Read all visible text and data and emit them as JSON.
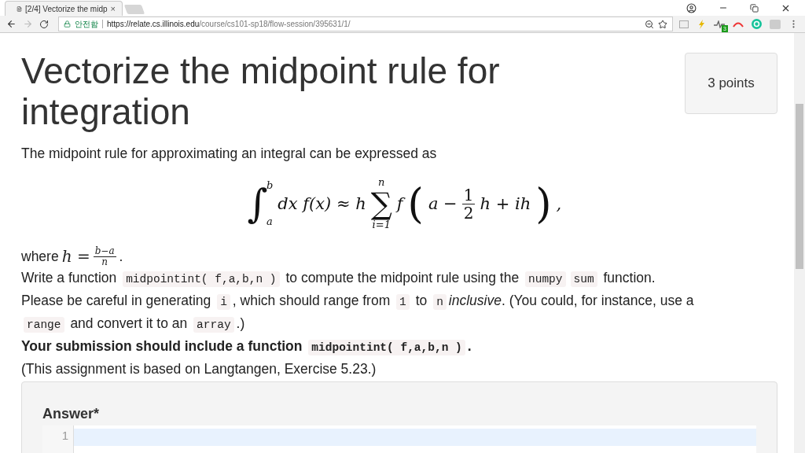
{
  "browser": {
    "tab": {
      "title": "[2/4] Vectorize the midp",
      "close": "×"
    },
    "address_bar": {
      "security_label": "안전함",
      "url_host": "https://relate.cs.illinois.edu",
      "url_path": "/course/cs101-sp18/flow-session/395631/1/"
    },
    "extension_badge": "3"
  },
  "page": {
    "title": "Vectorize the midpoint rule for integration",
    "points": "3 points",
    "intro": "The midpoint rule for approximating an integral can be expressed as",
    "formula": [
      {
        "kind": "limits",
        "op": "∫",
        "upper": "b",
        "lower": "a",
        "side": true
      },
      {
        "kind": "text",
        "text": "dx f(x) ≈ h"
      },
      {
        "kind": "limits",
        "op": "∑",
        "upper": "n",
        "lower": "i=1",
        "side": false
      },
      {
        "kind": "text",
        "text": "f"
      },
      {
        "kind": "paren",
        "text": "("
      },
      {
        "kind": "text",
        "text": "a −"
      },
      {
        "kind": "fraction",
        "num": "1",
        "den": "2"
      },
      {
        "kind": "text",
        "text": "h + ih"
      },
      {
        "kind": "paren",
        "text": ")"
      },
      {
        "kind": "text",
        "text": ","
      }
    ],
    "where": [
      {
        "kind": "text",
        "text": "where "
      },
      {
        "kind": "math",
        "text": "h ="
      },
      {
        "kind": "fraction",
        "num": "b−a",
        "den": "n"
      },
      {
        "kind": "text",
        "text": "."
      }
    ],
    "paragraphs": [
      {
        "bold": false,
        "segments": [
          {
            "kind": "text",
            "text": "Write a function "
          },
          {
            "kind": "code",
            "text": "midpointint( f,a,b,n )"
          },
          {
            "kind": "text",
            "text": " to compute the midpoint rule using the "
          },
          {
            "kind": "code",
            "text": "numpy"
          },
          {
            "kind": "code",
            "text": "sum"
          },
          {
            "kind": "text",
            "text": " function."
          }
        ]
      },
      {
        "bold": false,
        "segments": [
          {
            "kind": "text",
            "text": "Please be careful in generating "
          },
          {
            "kind": "code",
            "text": "i"
          },
          {
            "kind": "text",
            "text": ", which should range from "
          },
          {
            "kind": "code",
            "text": "1"
          },
          {
            "kind": "text",
            "text": " to "
          },
          {
            "kind": "code",
            "text": "n"
          },
          {
            "kind": "italic",
            "text": "inclusive"
          },
          {
            "kind": "text",
            "text": ". (You could, for instance, use a "
          },
          {
            "kind": "code",
            "text": "range"
          },
          {
            "kind": "text",
            "text": " and convert it to an "
          },
          {
            "kind": "code",
            "text": "array"
          },
          {
            "kind": "text",
            "text": ".)"
          }
        ]
      },
      {
        "bold": true,
        "segments": [
          {
            "kind": "text",
            "text": "Your submission should include a function "
          },
          {
            "kind": "code",
            "text": "midpointint( f,a,b,n )"
          },
          {
            "kind": "text",
            "text": "."
          }
        ]
      },
      {
        "bold": false,
        "segments": [
          {
            "kind": "text",
            "text": "(This assignment is based on Langtangen, Exercise 5.23.)"
          }
        ]
      }
    ],
    "answer": {
      "label": "Answer*",
      "line_numbers": [
        "1"
      ]
    }
  }
}
